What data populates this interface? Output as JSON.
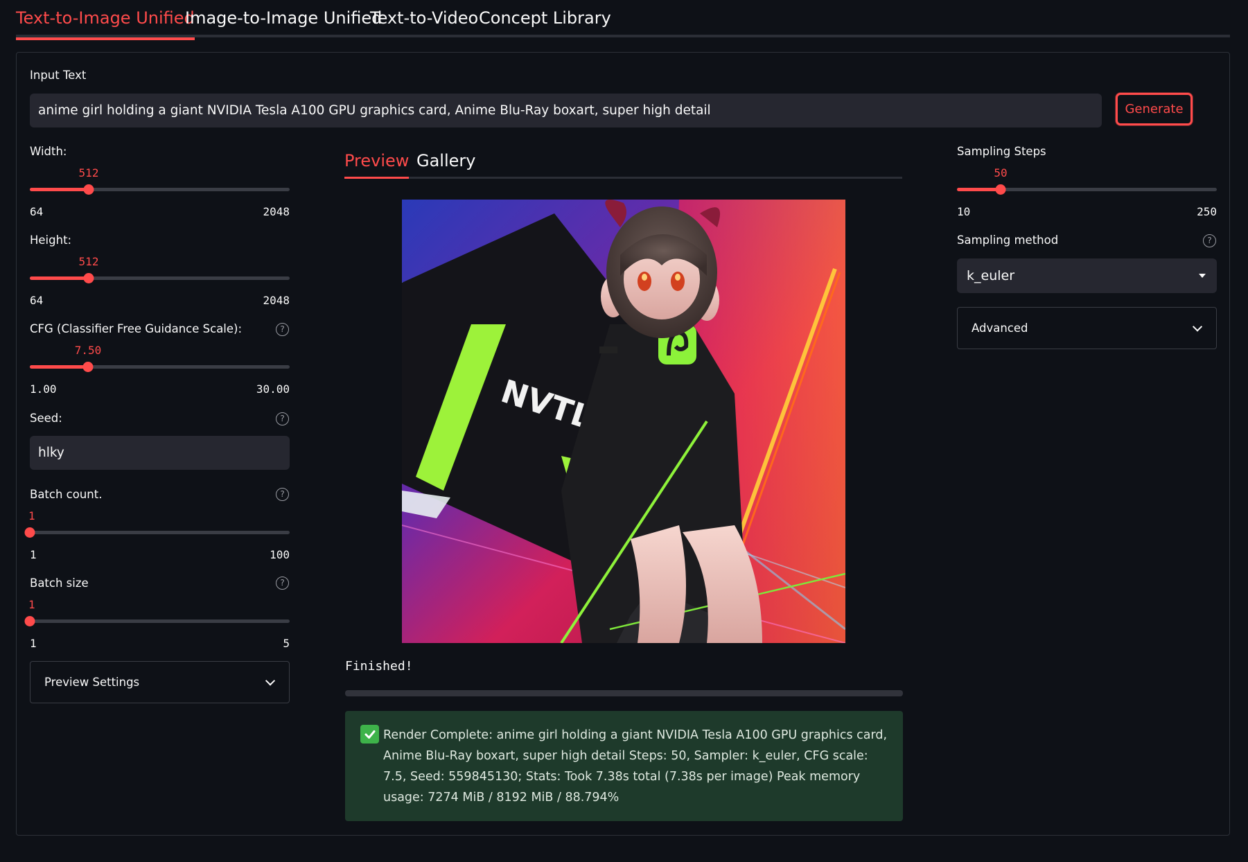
{
  "top_tabs": [
    {
      "label": "Text-to-Image Unified",
      "active": true
    },
    {
      "label": "Image-to-Image Unified",
      "active": false
    },
    {
      "label": "Text-to-Video",
      "active": false
    },
    {
      "label": "Concept Library",
      "active": false
    }
  ],
  "input_text": {
    "label": "Input Text",
    "value": "anime girl holding a giant NVIDIA Tesla A100 GPU graphics card, Anime Blu-Ray boxart, super high detail"
  },
  "generate_button": {
    "label": "Generate"
  },
  "width": {
    "label": "Width:",
    "value": "512",
    "min": "64",
    "max": "2048",
    "fraction": 0.2258
  },
  "height": {
    "label": "Height:",
    "value": "512",
    "min": "64",
    "max": "2048",
    "fraction": 0.2258
  },
  "cfg": {
    "label": "CFG (Classifier Free Guidance Scale):",
    "value": "7.50",
    "min": "1.00",
    "max": "30.00",
    "fraction": 0.2241
  },
  "seed": {
    "label": "Seed:",
    "value": "hlky"
  },
  "batch_count": {
    "label": "Batch count.",
    "value": "1",
    "min": "1",
    "max": "100",
    "fraction": 0
  },
  "batch_size": {
    "label": "Batch size",
    "value": "1",
    "min": "1",
    "max": "5",
    "fraction": 0
  },
  "preview_settings": {
    "label": "Preview Settings"
  },
  "inner_tabs": [
    {
      "label": "Preview",
      "active": true
    },
    {
      "label": "Gallery",
      "active": false
    }
  ],
  "status": {
    "text": "Finished!"
  },
  "result": {
    "message": "Render Complete: anime girl holding a giant NVIDIA Tesla A100 GPU graphics card, Anime Blu-Ray boxart, super high detail Steps: 50, Sampler: k_euler, CFG scale: 7.5, Seed: 559845130; Stats: Took 7.38s total (7.38s per image) Peak memory usage: 7274 MiB / 8192 MiB / 88.794%"
  },
  "sampling_steps": {
    "label": "Sampling Steps",
    "value": "50",
    "min": "10",
    "max": "250",
    "fraction": 0.1667
  },
  "sampling_method": {
    "label": "Sampling method",
    "value": "k_euler"
  },
  "advanced": {
    "label": "Advanced"
  },
  "image_text": "NVTLF",
  "colors": {
    "accent": "#ff4b4b",
    "background": "#0e1117",
    "input_bg": "#262730",
    "success_bg": "#1e3a2b"
  },
  "icons": {
    "help": "help-circle-icon",
    "chevron": "chevron-down-icon",
    "caret": "caret-down-icon",
    "check": "check-icon"
  }
}
